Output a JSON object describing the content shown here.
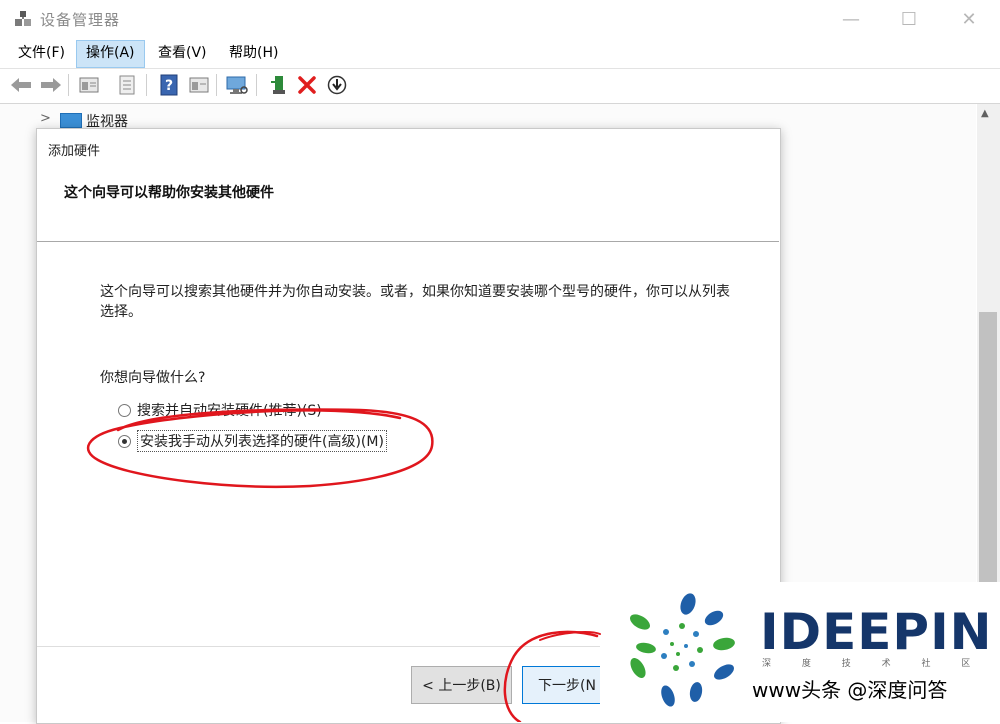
{
  "window": {
    "title": "设备管理器",
    "minimize_icon": "minimize-icon",
    "maximize_icon": "maximize-icon",
    "close_icon": "close-icon"
  },
  "menu": [
    {
      "label": "文件(F)",
      "active": false
    },
    {
      "label": "操作(A)",
      "active": true
    },
    {
      "label": "查看(V)",
      "active": false
    },
    {
      "label": "帮助(H)",
      "active": false
    }
  ],
  "toolbar": {
    "icons": [
      "back-arrow-icon",
      "forward-arrow-icon",
      "properties-icon",
      "update-driver-icon",
      "help-icon",
      "view-icon",
      "monitor-scan-icon",
      "add-device-icon",
      "remove-icon",
      "download-icon"
    ]
  },
  "tree": {
    "expand_glyph": ">",
    "item_label": "监视器"
  },
  "dialog": {
    "title": "添加硬件",
    "header": "这个向导可以帮助你安装其他硬件",
    "description": "这个向导可以搜索其他硬件并为你自动安装。或者，如果你知道要安装哪个型号的硬件，你可以从列表选择。",
    "question": "你想向导做什么?",
    "options": [
      {
        "label": "搜索并自动安装硬件(推荐)(S)",
        "selected": false
      },
      {
        "label": "安装我手动从列表选择的硬件(高级)(M)",
        "selected": true
      }
    ],
    "buttons": {
      "back": "< 上一步(B)",
      "next": "下一步(N"
    }
  },
  "watermark": {
    "brand": "IDEEPIN",
    "tagline": "深 度 技 术 社 区",
    "url_text": "www头条 @深度问答"
  },
  "colors": {
    "menu_active_bg": "#cce4f7",
    "annotation_red": "#e0161d",
    "brand_navy": "#15366a",
    "logo_green": "#3aa63a",
    "logo_blue": "#1f5fa8"
  }
}
